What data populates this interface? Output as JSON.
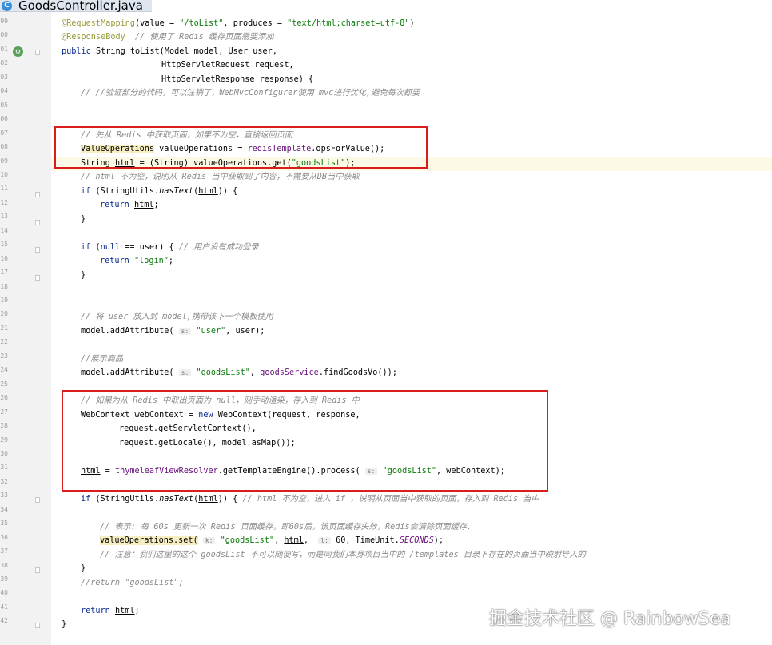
{
  "tab": {
    "icon_letter": "C",
    "title": "GoodsController.java"
  },
  "line_numbers": [
    "99",
    "00",
    "01",
    "02",
    "03",
    "04",
    "05",
    "06",
    "07",
    "08",
    "09",
    "10",
    "11",
    "12",
    "13",
    "14",
    "15",
    "16",
    "17",
    "18",
    "19",
    "20",
    "21",
    "22",
    "23",
    "24",
    "25",
    "26",
    "27",
    "28",
    "29",
    "30",
    "31",
    "32",
    "33",
    "34",
    "35",
    "36",
    "37",
    "38",
    "39",
    "40",
    "41",
    "42"
  ],
  "code": {
    "l1": {
      "annotation": "@RequestMapping",
      "a": "(value = ",
      "s1": "\"/toList\"",
      "b": ", produces = ",
      "s2": "\"text/html;charset=utf-8\"",
      "c": ")"
    },
    "l2": {
      "annotation": "@ResponseBody",
      "comment": "  // 使用了 Redis 缓存页面需要添加"
    },
    "l3": {
      "kw": "public",
      "rest": " String toList(Model model, User user,"
    },
    "l4": {
      "text": "HttpServletRequest request,"
    },
    "l5": {
      "text": "HttpServletResponse response) {"
    },
    "l6": {
      "comment": "// //验证部分的代码，可以注销了，WebMvcConfigurer使用 mvc进行优化,避免每次都要"
    },
    "l9": {
      "comment": "// 先从 Redis 中获取页面，如果不为空，直接返回页面"
    },
    "l10": {
      "type": "ValueOperations",
      "a": " valueOperations = ",
      "field": "redisTemplate",
      "b": ".opsForValue();"
    },
    "l11": {
      "a": "String ",
      "var": "html",
      "b": " = (String) valueOperations.get(",
      "str": "\"goodsList\"",
      "c": ");"
    },
    "l12": {
      "comment": "// html 不为空，说明从 Redis 当中获取到了内容，不需要从DB当中获取"
    },
    "l13": {
      "kw": "if",
      "a": " (StringUtils.",
      "method": "hasText",
      "b": "(",
      "var": "html",
      "c": ")) {"
    },
    "l14": {
      "kw": "return",
      "sp": " ",
      "var": "html",
      "end": ";"
    },
    "l15": {
      "text": "}"
    },
    "l17": {
      "kw": "if",
      "a": " (",
      "kw2": "null",
      "b": " == user) { ",
      "comment": "// 用户没有成功登录"
    },
    "l18": {
      "kw": "return",
      "sp": " ",
      "str": "\"login\"",
      "end": ";"
    },
    "l19": {
      "text": "}"
    },
    "l22": {
      "comment": "// 将 user 放入到 model,携带该下一个模板使用"
    },
    "l23": {
      "a": "model.addAttribute( ",
      "hint": "s:",
      "sp": " ",
      "str": "\"user\"",
      "b": ", user);"
    },
    "l25": {
      "comment": "//展示商品"
    },
    "l26": {
      "a": "model.addAttribute( ",
      "hint": "s:",
      "sp": " ",
      "str": "\"goodsList\"",
      "b": ", ",
      "field": "goodsService",
      "c": ".findGoodsVo());"
    },
    "l28": {
      "comment": "// 如果为从 Redis 中取出页面为 null，则手动渲染，存入到 Redis 中"
    },
    "l29": {
      "a": "WebContext webContext = ",
      "kw": "new",
      "b": " WebContext(request, response,"
    },
    "l30": {
      "text": "request.getServletContext(),"
    },
    "l31": {
      "text": "request.getLocale(), model.asMap());"
    },
    "l33": {
      "var": "html",
      "a": " = ",
      "field": "thymeleafViewResolver",
      "b": ".getTemplateEngine().process( ",
      "hint": "s:",
      "sp": " ",
      "str": "\"goodsList\"",
      "c": ", webContext);"
    },
    "l35": {
      "kw": "if",
      "a": " (StringUtils.",
      "method": "hasText",
      "b": "(",
      "var": "html",
      "c": ")) { ",
      "comment": "// html 不为空，进入 if ，说明从页面当中获取的页面，存入到 Redis 当中"
    },
    "l37": {
      "comment": "// 表示: 每 60s 更新一次 Redis 页面缓存，即60s后，该页面缓存失效，Redis会清除页面缓存."
    },
    "l38": {
      "hl": "valueOperations.set(",
      "sp": " ",
      "hint1": "k:",
      "sp2": " ",
      "str": "\"goodsList\"",
      "a": ", ",
      "var": "html",
      "b": ",  ",
      "hint2": "l:",
      "c": " 60, TimeUnit.",
      "const": "SECONDS",
      "d": ");"
    },
    "l39": {
      "comment": "// 注意：我们这里的这个 goodsList 不可以随便写，而是同我们本身项目当中的 /templates 目录下存在的页面当中映射导入的"
    },
    "l40": {
      "text": "}"
    },
    "l41": {
      "comment": "//return \"goodsList\";"
    },
    "l43": {
      "kw": "return",
      "sp": " ",
      "var": "html",
      "end": ";"
    },
    "l44": {
      "text": "}"
    }
  },
  "watermark": "掘金技术社区 @ RainbowSea",
  "colors": {
    "annotation_box": "#d91c1c",
    "current_line": "#fcfae6",
    "gutter": "#f2f2f2"
  }
}
